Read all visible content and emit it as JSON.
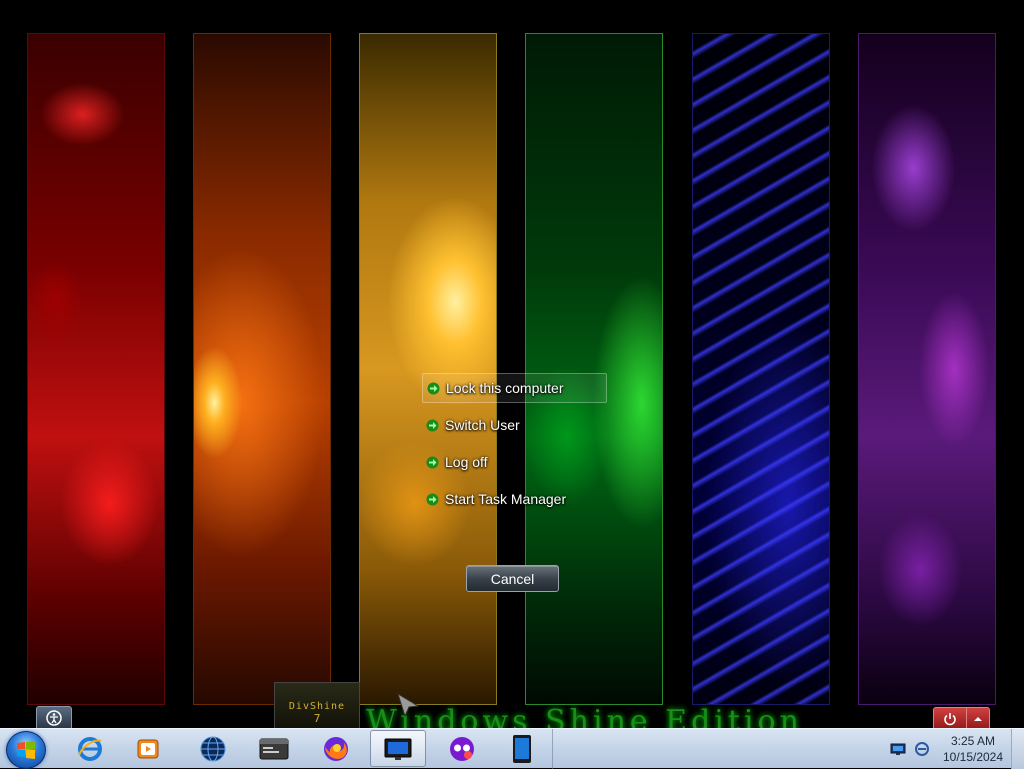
{
  "security_menu": {
    "items": [
      {
        "label": "Lock this computer",
        "hover": true
      },
      {
        "label": "Switch User"
      },
      {
        "label": "Log off"
      },
      {
        "label": "Start Task Manager"
      }
    ],
    "cancel_label": "Cancel"
  },
  "branding": {
    "box_line1": "DivShine",
    "box_line2": "7",
    "edition_text": "Windows Shine Edition"
  },
  "taskbar": {
    "pinned": [
      {
        "icon": "internet-explorer-icon"
      },
      {
        "icon": "media-player-icon"
      },
      {
        "icon": "globe-icon"
      },
      {
        "icon": "application-window-icon"
      },
      {
        "icon": "firefox-icon"
      },
      {
        "icon": "monitor-icon",
        "active": true
      },
      {
        "icon": "mask-app-icon"
      },
      {
        "icon": "tablet-icon"
      }
    ],
    "clock": {
      "time": "3:25 AM",
      "date": "10/15/2024"
    }
  },
  "colors": {
    "menu_arrow": "#3cd23c",
    "power_button": "#c03030",
    "edition_text": "#1ea81e"
  }
}
